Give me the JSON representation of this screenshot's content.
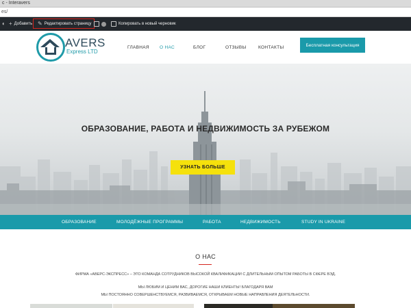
{
  "browser": {
    "tab_title": "с - Interavers",
    "url": "es/"
  },
  "adminbar": {
    "wp_logo_icon": "wordpress-icon",
    "add_label": "Добавить",
    "edit_label": "Редактировать страницу",
    "copy_label": "Копировать в новый черновик"
  },
  "header": {
    "brand_name": "AVERS",
    "brand_sub": "Express LTD",
    "nav": [
      "ГЛАВНАЯ",
      "О НАС",
      "БЛОГ",
      "ОТЗЫВЫ",
      "КОНТАКТЫ"
    ],
    "active_nav": "О НАС",
    "cta": "Бесплатная консультация"
  },
  "hero": {
    "title": "ОБРАЗОВАНИЕ, РАБОТА И НЕДВИЖИМОСТЬ ЗА РУБЕЖОМ",
    "button": "УЗНАТЬ БОЛЬШЕ"
  },
  "categories": [
    "ОБРАЗОВАНИЕ",
    "МОЛОДЁЖНЫЕ ПРОГРАММЫ",
    "РАБОТА",
    "НЕДВИЖИМОСТЬ",
    "STUDY IN UKRAINE"
  ],
  "about": {
    "title": "О НАС",
    "p1": "ФИРМА «АВЕРС-ЭКСПРЕСС» – ЭТО КОМАНДА СОТРУДНИКОВ ВЫСОКОЙ КВАЛИФИКАЦИИ С ДЛИТЕЛЬНЫМ ОПЫТОМ РАБОТЫ В СФЕРЕ ВЭД.",
    "p2": "МЫ ЛЮБИМ И ЦЕНИМ ВАС, ДОРОГИЕ НАШИ КЛИЕНТЫ! БЛАГОДАРЯ ВАМ",
    "p3": "МЫ ПОСТОЯННО СОВЕРШЕНСТВУЕМСЯ, РАЗВИВАЕМСЯ, ОТКРЫВАЕМ НОВЫЕ НАПРАВЛЕНИЯ ДЕЯТЕЛЬНОСТИ."
  },
  "colors": {
    "teal": "#1a9aaa",
    "adminbar": "#23282d",
    "accent_yellow": "#f5e10c",
    "highlight_red": "#d4251d"
  }
}
